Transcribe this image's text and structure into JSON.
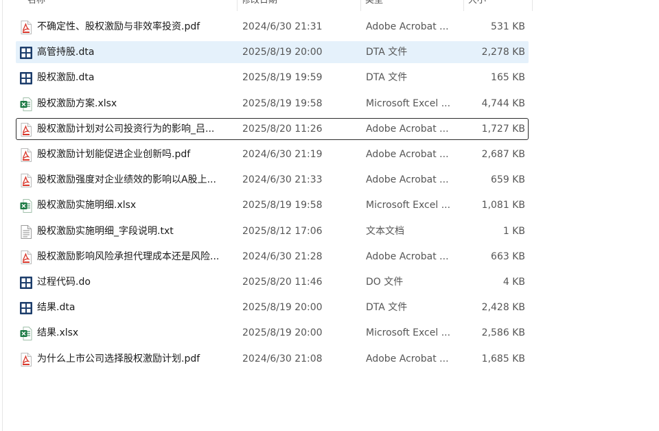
{
  "columns": {
    "name": "名称",
    "date": "修改日期",
    "type": "类型",
    "size": "大小"
  },
  "files": [
    {
      "name": "不确定性、股权激励与非效率投资.pdf",
      "date": "2024/6/30 21:31",
      "type": "Adobe Acrobat ...",
      "size": "531 KB",
      "icon": "pdf-icon",
      "selected": false,
      "focused": false
    },
    {
      "name": "高管持股.dta",
      "date": "2025/8/19 20:00",
      "type": "DTA 文件",
      "size": "2,278 KB",
      "icon": "stata-icon",
      "selected": true,
      "focused": false
    },
    {
      "name": "股权激励.dta",
      "date": "2025/8/19 19:59",
      "type": "DTA 文件",
      "size": "165 KB",
      "icon": "stata-icon",
      "selected": false,
      "focused": false
    },
    {
      "name": "股权激励方案.xlsx",
      "date": "2025/8/19 19:58",
      "type": "Microsoft Excel ...",
      "size": "4,744 KB",
      "icon": "excel-icon",
      "selected": false,
      "focused": false
    },
    {
      "name": "股权激励计划对公司投资行为的影响_吕...",
      "date": "2025/8/20 11:26",
      "type": "Adobe Acrobat ...",
      "size": "1,727 KB",
      "icon": "pdf-icon",
      "selected": false,
      "focused": true
    },
    {
      "name": "股权激励计划能促进企业创新吗.pdf",
      "date": "2024/6/30 21:19",
      "type": "Adobe Acrobat ...",
      "size": "2,687 KB",
      "icon": "pdf-icon",
      "selected": false,
      "focused": false
    },
    {
      "name": "股权激励强度对企业绩效的影响以A股上...",
      "date": "2024/6/30 21:33",
      "type": "Adobe Acrobat ...",
      "size": "659 KB",
      "icon": "pdf-icon",
      "selected": false,
      "focused": false
    },
    {
      "name": "股权激励实施明细.xlsx",
      "date": "2025/8/19 19:58",
      "type": "Microsoft Excel ...",
      "size": "1,081 KB",
      "icon": "excel-icon",
      "selected": false,
      "focused": false
    },
    {
      "name": "股权激励实施明细_字段说明.txt",
      "date": "2025/8/12 17:06",
      "type": "文本文档",
      "size": "1 KB",
      "icon": "text-file-icon",
      "selected": false,
      "focused": false
    },
    {
      "name": "股权激励影响风险承担代理成本还是风险...",
      "date": "2024/6/30 21:28",
      "type": "Adobe Acrobat ...",
      "size": "663 KB",
      "icon": "pdf-icon",
      "selected": false,
      "focused": false
    },
    {
      "name": "过程代码.do",
      "date": "2025/8/20 11:46",
      "type": "DO 文件",
      "size": "4 KB",
      "icon": "stata-icon",
      "selected": false,
      "focused": false
    },
    {
      "name": "结果.dta",
      "date": "2025/8/19 20:00",
      "type": "DTA 文件",
      "size": "2,428 KB",
      "icon": "stata-icon",
      "selected": false,
      "focused": false
    },
    {
      "name": "结果.xlsx",
      "date": "2025/8/19 20:00",
      "type": "Microsoft Excel ...",
      "size": "2,586 KB",
      "icon": "excel-icon",
      "selected": false,
      "focused": false
    },
    {
      "name": "为什么上市公司选择股权激励计划.pdf",
      "date": "2024/6/30 21:08",
      "type": "Adobe Acrobat ...",
      "size": "1,685 KB",
      "icon": "pdf-icon",
      "selected": false,
      "focused": false
    }
  ],
  "colors": {
    "selected_row": "#e5f1fb",
    "pdf_red": "#d9372b",
    "excel_green": "#1d7a45",
    "stata_navy": "#1c3d6b"
  }
}
